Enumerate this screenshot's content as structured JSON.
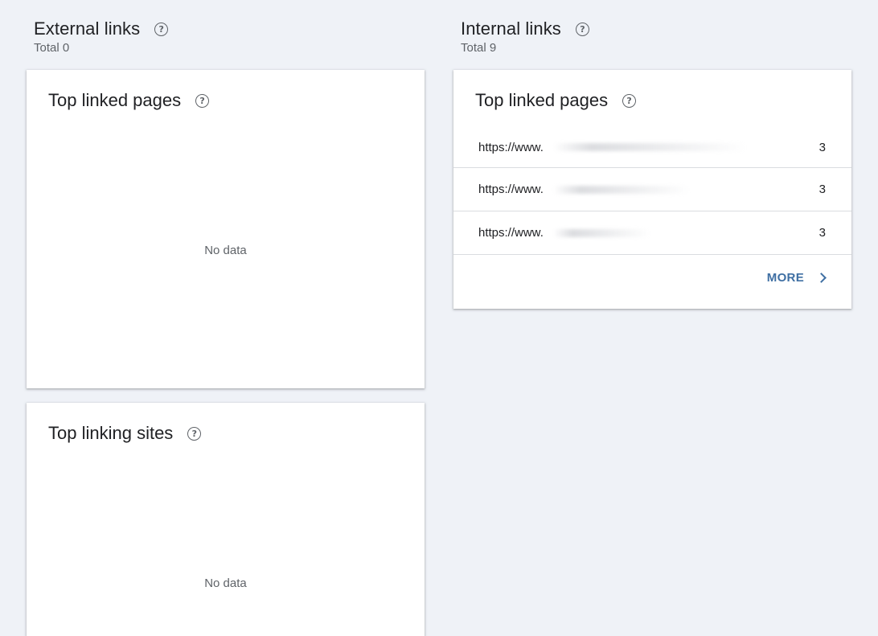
{
  "external": {
    "title": "External links",
    "total": "Total 0",
    "top_linked_pages": {
      "title": "Top linked pages",
      "empty": "No data"
    },
    "top_linking_sites": {
      "title": "Top linking sites",
      "empty": "No data"
    }
  },
  "internal": {
    "title": "Internal links",
    "total": "Total 9",
    "top_linked_pages": {
      "title": "Top linked pages",
      "rows": [
        {
          "url": "https://www.",
          "count": "3"
        },
        {
          "url": "https://www.",
          "count": "3"
        },
        {
          "url": "https://www.",
          "count": "3"
        }
      ],
      "more_label": "MORE"
    }
  },
  "icons": {
    "help": "help-circle-icon",
    "more": "chevron-right-icon"
  },
  "colors": {
    "background": "#eff2f7",
    "accent": "#3f6fa3"
  }
}
